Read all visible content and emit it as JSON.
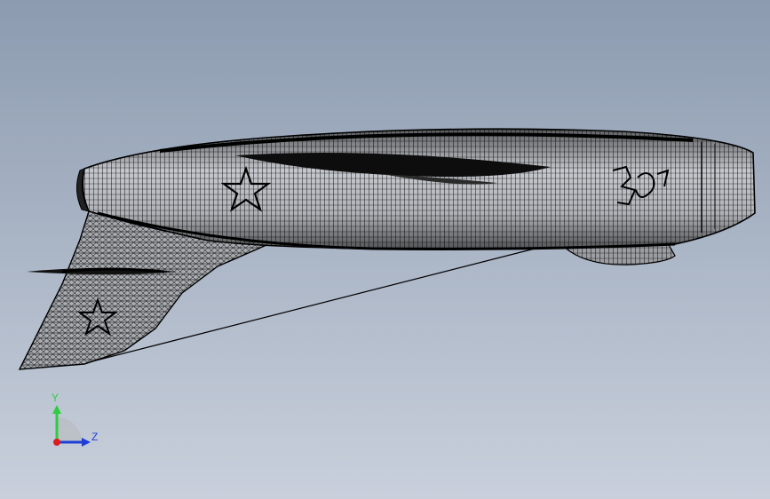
{
  "viewport": {
    "background_top": "#8c9bb0",
    "background_bottom": "#c9d0dc",
    "mesh_color": "#000000",
    "model_fill": "#d9dbe0"
  },
  "triad": {
    "y_label": "Y",
    "z_label": "Z",
    "y_color": "#2ecc40",
    "z_color": "#1f3fd6",
    "x_color": "#e01b1b"
  }
}
